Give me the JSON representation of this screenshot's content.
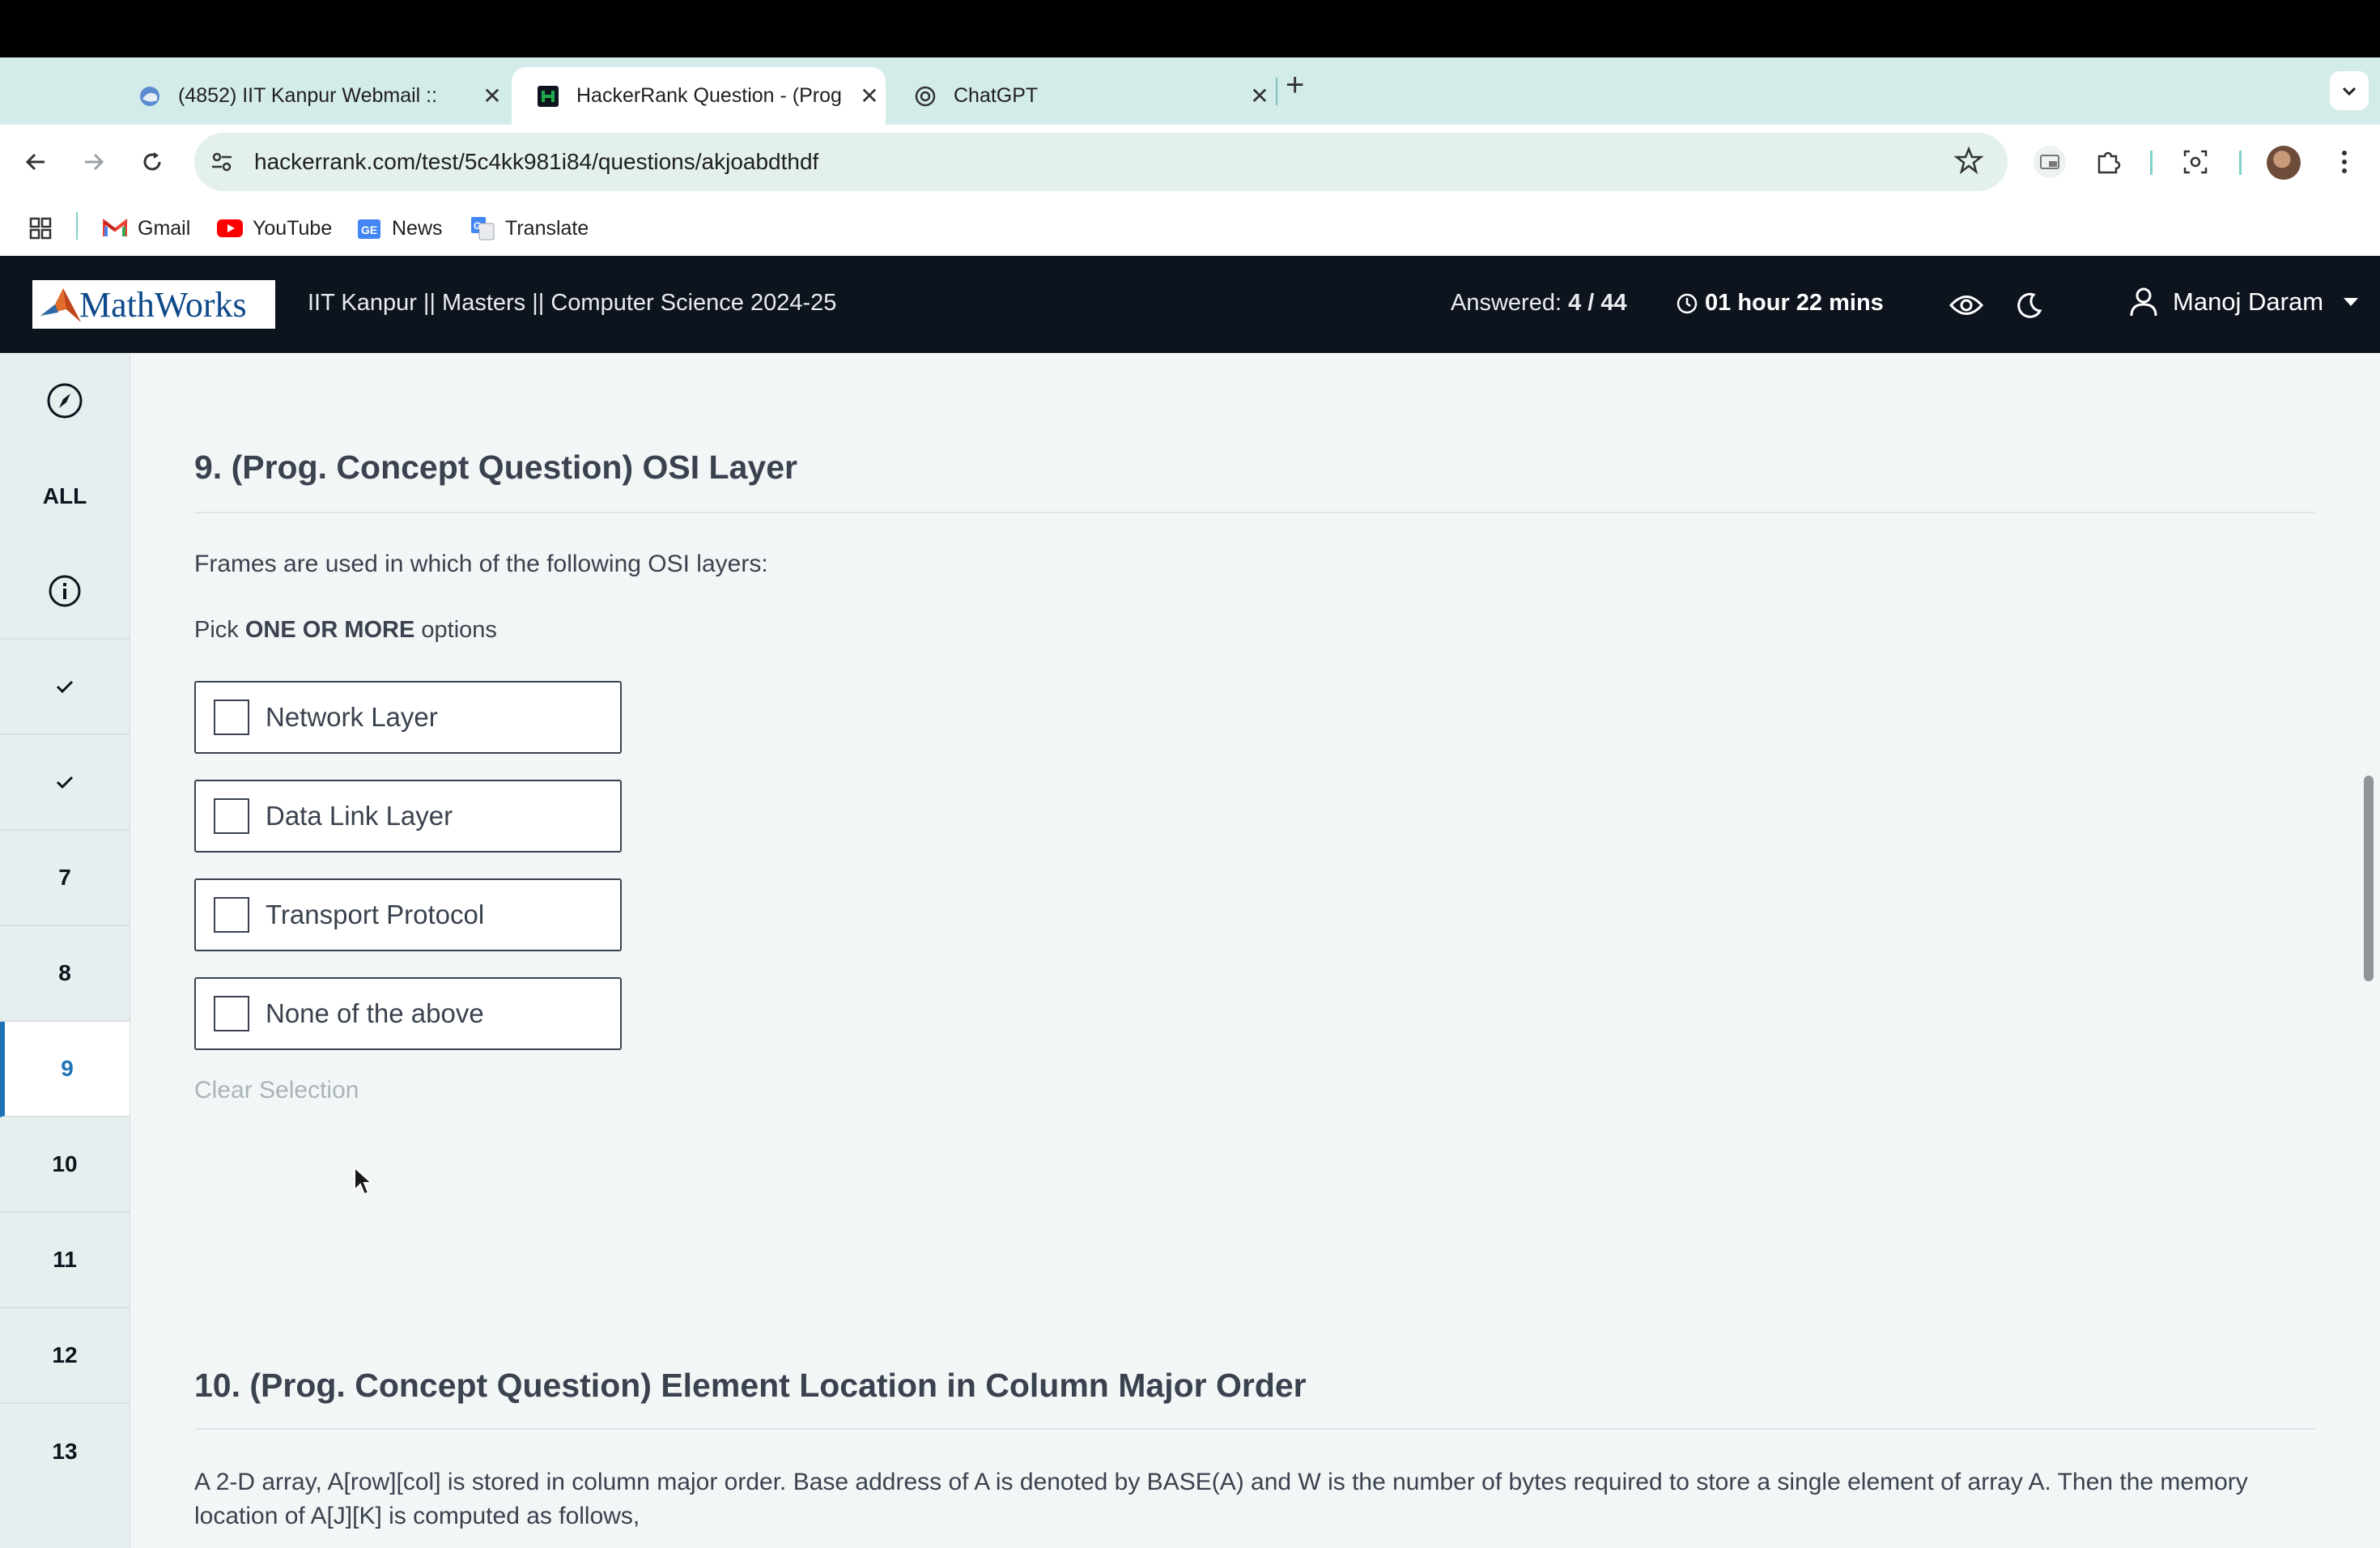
{
  "browser": {
    "tabs": [
      {
        "title": "(4852) IIT Kanpur Webmail ::",
        "favicon": "webmail-icon",
        "active": false
      },
      {
        "title": "HackerRank Question - (Prog",
        "favicon": "hackerrank-icon",
        "active": true
      },
      {
        "title": "ChatGPT",
        "favicon": "chatgpt-icon",
        "active": false
      }
    ],
    "url": "hackerrank.com/test/5c4kk981i84/questions/akjoabdthdf",
    "bookmarks": [
      {
        "label": "Gmail",
        "icon": "gmail-icon"
      },
      {
        "label": "YouTube",
        "icon": "youtube-icon"
      },
      {
        "label": "News",
        "icon": "news-icon"
      },
      {
        "label": "Translate",
        "icon": "translate-icon"
      }
    ]
  },
  "header": {
    "logo_text": "MathWorks",
    "test_title": "IIT Kanpur || Masters || Computer Science 2024-25",
    "answered_label": "Answered:",
    "answered_value": "4 / 44",
    "time_remaining": "01 hour 22 mins",
    "user_name": "Manoj Daram",
    "colors": {
      "header_bg": "#0e141e",
      "accent": "#1f72b8"
    }
  },
  "sidebar": {
    "items": [
      {
        "label": "",
        "icon": "compass-icon"
      },
      {
        "label": "ALL"
      },
      {
        "label": "",
        "icon": "info-icon"
      },
      {
        "label": "",
        "icon": "check-icon",
        "status": "answered"
      },
      {
        "label": "",
        "icon": "check-icon",
        "status": "answered"
      },
      {
        "label": "7"
      },
      {
        "label": "8"
      },
      {
        "label": "9",
        "current": true
      },
      {
        "label": "10"
      },
      {
        "label": "11"
      },
      {
        "label": "12"
      },
      {
        "label": "13"
      }
    ]
  },
  "questions": [
    {
      "title": "9. (Prog. Concept Question) OSI Layer",
      "text": "Frames are used in which of the following OSI layers:",
      "pick_prefix": "Pick",
      "pick_bold": "ONE OR MORE",
      "pick_suffix": "options",
      "options": [
        "Network Layer",
        "Data Link Layer",
        "Transport Protocol",
        "None of the above"
      ],
      "clear_label": "Clear Selection"
    },
    {
      "title": "10. (Prog. Concept Question) Element Location in Column Major Order",
      "text": "A 2-D array, A[row][col] is stored in column major order. Base address of A is denoted by BASE(A) and W is the number of bytes required to store a single element of array A. Then the memory location of A[J][K] is computed as follows,"
    }
  ]
}
